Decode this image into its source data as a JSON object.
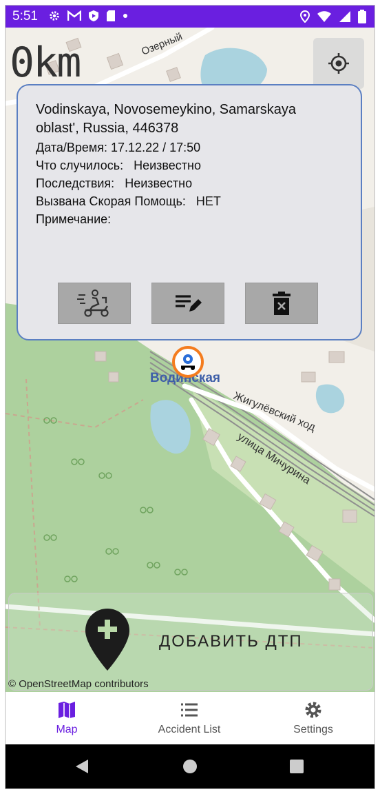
{
  "status_bar": {
    "time": "5:51"
  },
  "speed": {
    "value": "0km"
  },
  "map": {
    "place_label": "Водинская",
    "street1": "Жигулёвский ход",
    "street2": "улица Мичурина",
    "street3": "Озерный",
    "attribution": "© OpenStreetMap contributors"
  },
  "card": {
    "address": "Vodinskaya, Novosemeykino, Samarskaya oblast', Russia, 446378",
    "datetime_label": "Дата/Время:",
    "datetime_value": "17.12.22 / 17:50",
    "what_label": "Что случилось:",
    "what_value": "Неизвестно",
    "consequences_label": "Последствия:",
    "consequences_value": "Неизвестно",
    "ambulance_label": "Вызвана Скорая Помощь:",
    "ambulance_value": "НЕТ",
    "note_label": "Примечание:",
    "note_value": "",
    "buttons": [
      "courier-icon",
      "edit-list-icon",
      "delete-icon"
    ]
  },
  "add_accident": {
    "label": "ДОБАВИТЬ ДТП"
  },
  "bottom_nav": {
    "items": [
      {
        "label": "Map",
        "active": true
      },
      {
        "label": "Accident List",
        "active": false
      },
      {
        "label": "Settings",
        "active": false
      }
    ]
  },
  "colors": {
    "accent": "#6a1fe0",
    "card_border": "#5b7fc2",
    "marker": "#f47c1e"
  }
}
